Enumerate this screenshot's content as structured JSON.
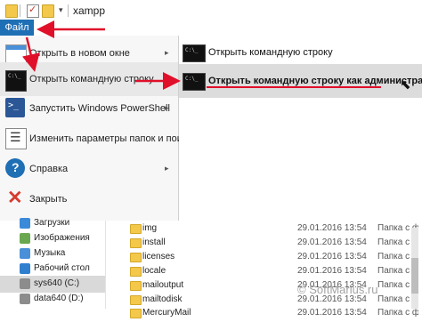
{
  "window": {
    "title": "xampp"
  },
  "ribbon": {
    "file_tab": "Файл"
  },
  "menu": {
    "items": [
      {
        "label": "Открыть в новом окне",
        "icon": "new-window-icon",
        "has_submenu": true
      },
      {
        "label": "Открыть командную строку",
        "icon": "command-prompt-icon",
        "has_submenu": true,
        "selected": true
      },
      {
        "label": "Запустить Windows PowerShell",
        "icon": "powershell-icon",
        "has_submenu": true
      },
      {
        "label": "Изменить параметры папок и поиска",
        "icon": "folder-options-icon",
        "has_submenu": false
      },
      {
        "label": "Справка",
        "icon": "help-icon",
        "has_submenu": true
      },
      {
        "label": "Закрыть",
        "icon": "close-icon",
        "has_submenu": false
      }
    ]
  },
  "submenu": {
    "items": [
      {
        "label": "Открыть командную строку",
        "icon": "command-prompt-icon"
      },
      {
        "label": "Открыть командную строку как администратор",
        "icon": "admin-command-prompt-icon",
        "highlighted": true
      }
    ]
  },
  "navigation": {
    "items": [
      {
        "label": "Загрузки",
        "icon": "downloads-icon"
      },
      {
        "label": "Изображения",
        "icon": "pictures-icon"
      },
      {
        "label": "Музыка",
        "icon": "music-icon"
      },
      {
        "label": "Рабочий стол",
        "icon": "desktop-icon"
      },
      {
        "label": "sys640 (C:)",
        "icon": "drive-icon",
        "active": true
      },
      {
        "label": "data640 (D:)",
        "icon": "drive-icon"
      }
    ]
  },
  "files": {
    "rows": [
      {
        "name": "img",
        "date": "29.01.2016 13:54",
        "type": "Папка с файлами"
      },
      {
        "name": "install",
        "date": "29.01.2016 13:54",
        "type": "Папка с файлами"
      },
      {
        "name": "licenses",
        "date": "29.01.2016 13:54",
        "type": "Папка с файлами"
      },
      {
        "name": "locale",
        "date": "29.01.2016 13:54",
        "type": "Папка с файлами"
      },
      {
        "name": "mailoutput",
        "date": "29.01.2016 13:54",
        "type": "Папка с файлами"
      },
      {
        "name": "mailtodisk",
        "date": "29.01.2016 13:54",
        "type": "Папка с файлами"
      },
      {
        "name": "MercuryMail",
        "date": "29.01.2016 13:54",
        "type": "Папка с файлами"
      }
    ]
  },
  "watermark": "© SoftMarius.ru",
  "colors": {
    "accent": "#1f6fb5",
    "annotation": "#e0102a",
    "highlight": "#dcdcdc"
  }
}
